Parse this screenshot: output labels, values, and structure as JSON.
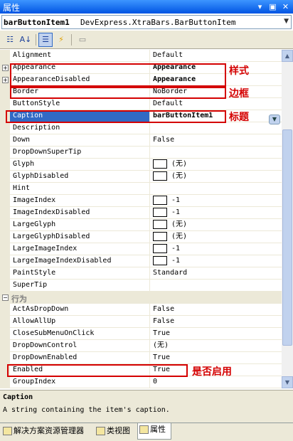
{
  "window": {
    "title": "属性"
  },
  "object_selector": {
    "name": "barButtonItem1",
    "type": "DevExpress.XtraBars.BarButtonItem"
  },
  "toolbar": {
    "categorized": "Categorized",
    "alphabetical": "Alphabetical",
    "properties": "Properties",
    "events": "Events",
    "property_pages": "Property Pages"
  },
  "rows": [
    {
      "name": "Alignment",
      "value": "Default"
    },
    {
      "name": "Appearance",
      "value": "Appearance",
      "expand": "+",
      "bold": true
    },
    {
      "name": "AppearanceDisabled",
      "value": "Appearance",
      "expand": "+",
      "bold": true
    },
    {
      "name": "Border",
      "value": "NoBorder"
    },
    {
      "name": "ButtonStyle",
      "value": "Default"
    },
    {
      "name": "Caption",
      "value": "barButtonItem1",
      "selected": true,
      "bold": true
    },
    {
      "name": "Description",
      "value": ""
    },
    {
      "name": "Down",
      "value": "False"
    },
    {
      "name": "DropDownSuperTip",
      "value": ""
    },
    {
      "name": "Glyph",
      "value": "(无)",
      "swatch": true
    },
    {
      "name": "GlyphDisabled",
      "value": "(无)",
      "swatch": true
    },
    {
      "name": "Hint",
      "value": ""
    },
    {
      "name": "ImageIndex",
      "value": "-1",
      "swatch": true
    },
    {
      "name": "ImageIndexDisabled",
      "value": "-1",
      "swatch": true
    },
    {
      "name": "LargeGlyph",
      "value": "(无)",
      "swatch": true
    },
    {
      "name": "LargeGlyphDisabled",
      "value": "(无)",
      "swatch": true
    },
    {
      "name": "LargeImageIndex",
      "value": "-1",
      "swatch": true
    },
    {
      "name": "LargeImageIndexDisabled",
      "value": "-1",
      "swatch": true
    },
    {
      "name": "PaintStyle",
      "value": "Standard"
    },
    {
      "name": "SuperTip",
      "value": ""
    }
  ],
  "category": {
    "label": "行为",
    "expand": "−"
  },
  "rows2": [
    {
      "name": "ActAsDropDown",
      "value": "False"
    },
    {
      "name": "AllowAllUp",
      "value": "False"
    },
    {
      "name": "CloseSubMenuOnClick",
      "value": "True"
    },
    {
      "name": "DropDownControl",
      "value": "(无)"
    },
    {
      "name": "DropDownEnabled",
      "value": "True"
    },
    {
      "name": "Enabled",
      "value": "True"
    },
    {
      "name": "GroupIndex",
      "value": "0"
    }
  ],
  "annotations": {
    "style": "样式",
    "border": "边框",
    "caption": "标题",
    "enabled": "是否启用",
    "color": "#d40000"
  },
  "description": {
    "title": "Caption",
    "text": "A string containing the item's caption."
  },
  "tabs": [
    {
      "label": "解决方案资源管理器"
    },
    {
      "label": "类视图"
    },
    {
      "label": "属性"
    }
  ],
  "colors": {
    "title_bar": "#0054e3",
    "selection": "#316ac5",
    "panel": "#ece9d8"
  }
}
